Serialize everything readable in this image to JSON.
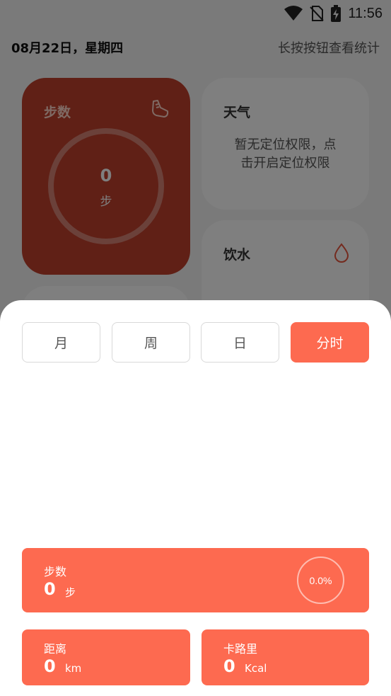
{
  "status_bar": {
    "time": "11:56"
  },
  "header": {
    "date": "08月22日，星期四",
    "hint": "长按按钮查看统计"
  },
  "cards": {
    "steps": {
      "title": "步数",
      "value": "0",
      "unit": "步"
    },
    "weather": {
      "title": "天气",
      "message_line1": "暂无定位权限，点",
      "message_line2": "击开启定位权限"
    },
    "water": {
      "title": "饮水"
    }
  },
  "sheet": {
    "tabs": [
      {
        "label": "月"
      },
      {
        "label": "周"
      },
      {
        "label": "日"
      },
      {
        "label": "分时"
      }
    ],
    "active_tab": "分时",
    "steps": {
      "label": "步数",
      "value": "0",
      "unit": "步",
      "percent": "0.0%"
    },
    "distance": {
      "label": "距离",
      "value": "0",
      "unit": "km"
    },
    "calories": {
      "label": "卡路里",
      "value": "0",
      "unit": "Kcal"
    }
  },
  "colors": {
    "accent": "#fd6a50",
    "steps_card": "#c0402c",
    "scrim": "rgba(0,0,0,0.5)"
  },
  "icons": [
    "wifi-icon",
    "no-sim-icon",
    "battery-charging-icon",
    "shoe-icon",
    "water-drop-icon"
  ]
}
